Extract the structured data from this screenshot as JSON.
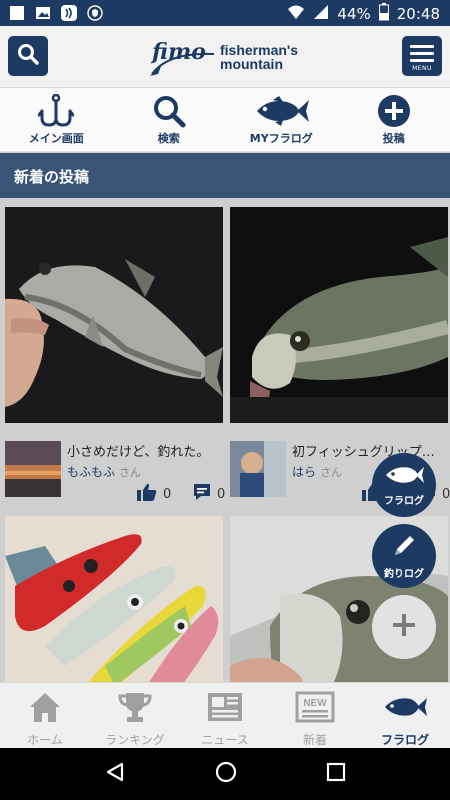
{
  "status_bar": {
    "battery": "44%",
    "time": "20:48",
    "icons": [
      "notification-square-icon",
      "image-icon",
      "nfc-icon",
      "shield-icon",
      "wifi-icon",
      "signal-icon",
      "battery-icon"
    ]
  },
  "header": {
    "logo_script": "fimo",
    "logo_line1": "fisherman's",
    "logo_line2": "mountain",
    "menu_label": "MENU"
  },
  "nav": {
    "items": [
      {
        "label": "メイン画面",
        "icon": "fishhook-icon"
      },
      {
        "label": "検索",
        "icon": "search-icon"
      },
      {
        "label": "MYフラログ",
        "icon": "fish-icon"
      },
      {
        "label": "投稿",
        "icon": "plus-circle-icon"
      }
    ]
  },
  "section_title": "新着の投稿",
  "posts": [
    {
      "title": "小さめだけど、釣れた。",
      "author": "もふもふ",
      "honorific": "さん",
      "likes": "0",
      "comments": "0"
    },
    {
      "title": "初フィッシュグリップ…",
      "author": "はら",
      "honorific": "さん",
      "likes": "0",
      "comments": "0"
    },
    {
      "title": "",
      "author": "",
      "honorific": ""
    },
    {
      "title": "",
      "author": "",
      "honorific": ""
    }
  ],
  "fabs": {
    "fralog": "フラログ",
    "fishing_log": "釣りログ",
    "add_icon": "plus-icon"
  },
  "tabbar": {
    "tabs": [
      {
        "label": "ホーム",
        "icon": "home-icon",
        "active": false
      },
      {
        "label": "ランキング",
        "icon": "trophy-icon",
        "active": false
      },
      {
        "label": "ニュース",
        "icon": "newspaper-icon",
        "active": false
      },
      {
        "label": "新着",
        "icon": "new-badge-icon",
        "active": false
      },
      {
        "label": "フラログ",
        "icon": "fish-icon",
        "active": true
      }
    ]
  },
  "colors": {
    "brand": "#1d3a63",
    "section": "#3a5478",
    "inactive": "#a0a0a0"
  }
}
